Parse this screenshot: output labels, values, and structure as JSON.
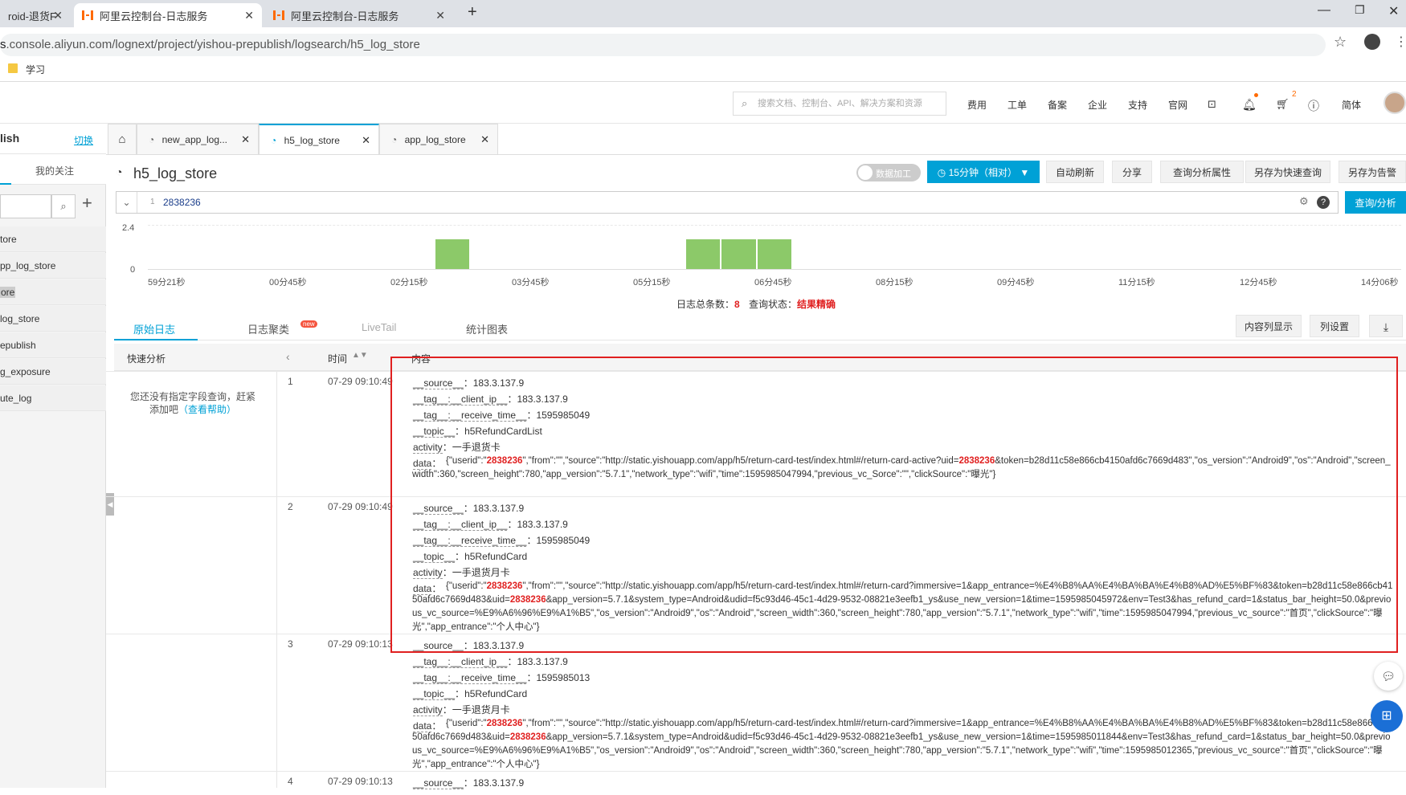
{
  "browser": {
    "tabs": [
      {
        "label": "roid-退货F"
      },
      {
        "label": "阿里云控制台-日志服务"
      },
      {
        "label": "阿里云控制台-日志服务"
      }
    ],
    "url": ".console.aliyun.com/lognext/project/yishou-prepublish/logsearch/h5_log_store",
    "url_prefix": "s",
    "bookmark": "学习"
  },
  "console": {
    "search_placeholder": "搜索文档、控制台、API、解决方案和资源",
    "nav": [
      "费用",
      "工单",
      "备案",
      "企业",
      "支持",
      "官网"
    ],
    "cart_badge": "2",
    "lang": "简体"
  },
  "left": {
    "project": "lish",
    "switch": "切换",
    "my_follow": "我的关注",
    "stores": [
      "tore",
      "pp_log_store",
      "ore",
      "log_store",
      "epublish",
      "g_exposure",
      "ute_log"
    ]
  },
  "tabs": [
    {
      "label": "new_app_log..."
    },
    {
      "label": "h5_log_store"
    },
    {
      "label": "app_log_store"
    }
  ],
  "title": "h5_log_store",
  "toolbar": {
    "data_process": "数据加工",
    "time_range": "15分钟（相对）",
    "auto_refresh": "自动刷新",
    "share": "分享",
    "query_props": "查询分析属性",
    "save_quick": "另存为快速查询",
    "save_alert": "另存为告警",
    "query_btn": "查询/分析"
  },
  "query": {
    "line": "1",
    "text": "2838236"
  },
  "histogram": {
    "y_ticks": [
      "2.4",
      "0"
    ],
    "x_ticks": [
      "59分21秒",
      "00分45秒",
      "02分15秒",
      "03分45秒",
      "05分15秒",
      "06分45秒",
      "08分15秒",
      "09分45秒",
      "11分15秒",
      "12分45秒",
      "14分06秒"
    ],
    "bars": [
      {
        "slot": 8,
        "value": 1
      },
      {
        "slot": 15,
        "value": 1
      },
      {
        "slot": 16,
        "value": 1
      },
      {
        "slot": 17,
        "value": 1
      }
    ]
  },
  "status": {
    "total_label": "日志总条数：",
    "total": "8",
    "state_label": "查询状态：",
    "state": "结果精确"
  },
  "view_tabs": {
    "raw": "原始日志",
    "cluster": "日志聚类",
    "new_badge": "new",
    "livetail": "LiveTail",
    "stats": "统计图表"
  },
  "view_buttons": {
    "content_col": "内容列显示",
    "col_settings": "列设置"
  },
  "table": {
    "quick_analysis": "快速分析",
    "time_header": "时间",
    "content_header": "内容",
    "hint_line1": "您还没有指定字段查询，赶紧",
    "hint_line2": "添加吧",
    "hint_link": "（查看帮助）"
  },
  "logs": [
    {
      "n": "1",
      "time": "07-29 09:10:49",
      "fields": [
        {
          "k": "__source__",
          "v": "183.3.137.9"
        },
        {
          "k": "__tag__:__client_ip__",
          "v": "183.3.137.9"
        },
        {
          "k": "__tag__:__receive_time__",
          "v": "1595985049"
        },
        {
          "k": "__topic__",
          "v": "h5RefundCardList"
        },
        {
          "k": "activity",
          "v": "一手退货卡"
        }
      ],
      "data_parts": [
        "{\"userid\":\"",
        "2838236",
        "\",\"from\":\"\",\"source\":\"http://static.yishouapp.com/app/h5/return-card-test/index.html#/return-card-active?uid=",
        "2838236",
        "&token=b28d11c58e866cb4150afd6c7669d483\",\"os_version\":\"Android9\",\"os\":\"Android\",\"screen_width\":360,\"screen_height\":780,\"app_version\":\"5.7.1\",\"network_type\":\"wifi\",\"time\":1595985047994,\"previous_vc_Sorce\":\"\",\"clickSource\":\"曝光\"}"
      ]
    },
    {
      "n": "2",
      "time": "07-29 09:10:49",
      "fields": [
        {
          "k": "__source__",
          "v": "183.3.137.9"
        },
        {
          "k": "__tag__:__client_ip__",
          "v": "183.3.137.9"
        },
        {
          "k": "__tag__:__receive_time__",
          "v": "1595985049"
        },
        {
          "k": "__topic__",
          "v": "h5RefundCard"
        },
        {
          "k": "activity",
          "v": "一手退货月卡"
        }
      ],
      "data_parts": [
        "{\"userid\":\"",
        "2838236",
        "\",\"from\":\"\",\"source\":\"http://static.yishouapp.com/app/h5/return-card-test/index.html#/return-card?immersive=1&app_entrance=%E4%B8%AA%E4%BA%BA%E4%B8%AD%E5%BF%83&token=b28d11c58e866cb4150afd6c7669d483&uid=",
        "2838236",
        "&app_version=5.7.1&system_type=Android&udid=f5c93d46-45c1-4d29-9532-08821e3eefb1_ys&use_new_version=1&time=1595985045972&env=Test3&has_refund_card=1&status_bar_height=50.0&previous_vc_source=%E9%A6%96%E9%A1%B5\",\"os_version\":\"Android9\",\"os\":\"Android\",\"screen_width\":360,\"screen_height\":780,\"app_version\":\"5.7.1\",\"network_type\":\"wifi\",\"time\":1595985047994,\"previous_vc_source\":\"首页\",\"clickSource\":\"曝光\",\"app_entrance\":\"个人中心\"}"
      ]
    },
    {
      "n": "3",
      "time": "07-29 09:10:13",
      "fields": [
        {
          "k": "__source__",
          "v": "183.3.137.9"
        },
        {
          "k": "__tag__:__client_ip__",
          "v": "183.3.137.9"
        },
        {
          "k": "__tag__:__receive_time__",
          "v": "1595985013"
        },
        {
          "k": "__topic__",
          "v": "h5RefundCard"
        },
        {
          "k": "activity",
          "v": "一手退货月卡"
        }
      ],
      "data_parts": [
        "{\"userid\":\"",
        "2838236",
        "\",\"from\":\"\",\"source\":\"http://static.yishouapp.com/app/h5/return-card-test/index.html#/return-card?immersive=1&app_entrance=%E4%B8%AA%E4%BA%BA%E4%B8%AD%E5%BF%83&token=b28d11c58e866cb4150afd6c7669d483&uid=",
        "2838236",
        "&app_version=5.7.1&system_type=Android&udid=f5c93d46-45c1-4d29-9532-08821e3eefb1_ys&use_new_version=1&time=1595985011844&env=Test3&has_refund_card=1&status_bar_height=50.0&previous_vc_source=%E9%A6%96%E9%A1%B5\",\"os_version\":\"Android9\",\"os\":\"Android\",\"screen_width\":360,\"screen_height\":780,\"app_version\":\"5.7.1\",\"network_type\":\"wifi\",\"time\":1595985012365,\"previous_vc_source\":\"首页\",\"clickSource\":\"曝光\",\"app_entrance\":\"个人中心\"}"
      ]
    },
    {
      "n": "4",
      "time": "07-29 09:10:13",
      "fields": [
        {
          "k": "__source__",
          "v": "183.3.137.9"
        }
      ],
      "data_parts": []
    }
  ],
  "data_key": "data",
  "colors": {
    "accent": "#00a1d6",
    "bar": "#8cc969",
    "highlight": "#e02020",
    "box": "#e02020"
  }
}
